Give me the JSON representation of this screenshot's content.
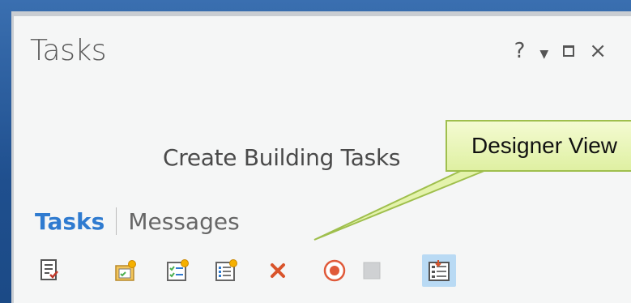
{
  "pane": {
    "title": "Tasks",
    "help_label": "?",
    "close_label": "×"
  },
  "task_item": {
    "name": "Create Building Tasks"
  },
  "tabs": [
    {
      "label": "Tasks",
      "active": true
    },
    {
      "label": "Messages",
      "active": false
    }
  ],
  "toolbar": {
    "buttons": [
      {
        "icon": "task-item-properties-icon"
      },
      {
        "icon": "new-task-group-icon"
      },
      {
        "icon": "new-task-icon"
      },
      {
        "icon": "new-step-icon"
      },
      {
        "icon": "delete-icon"
      },
      {
        "icon": "record-icon"
      },
      {
        "icon": "stop-icon"
      },
      {
        "icon": "designer-view-icon",
        "selected": true
      }
    ]
  },
  "callout": {
    "text": "Designer View"
  },
  "colors": {
    "accent": "#2f7bd0",
    "delete": "#d9542b",
    "record": "#e05a3a",
    "callout_fill": "#e9f5b8"
  }
}
